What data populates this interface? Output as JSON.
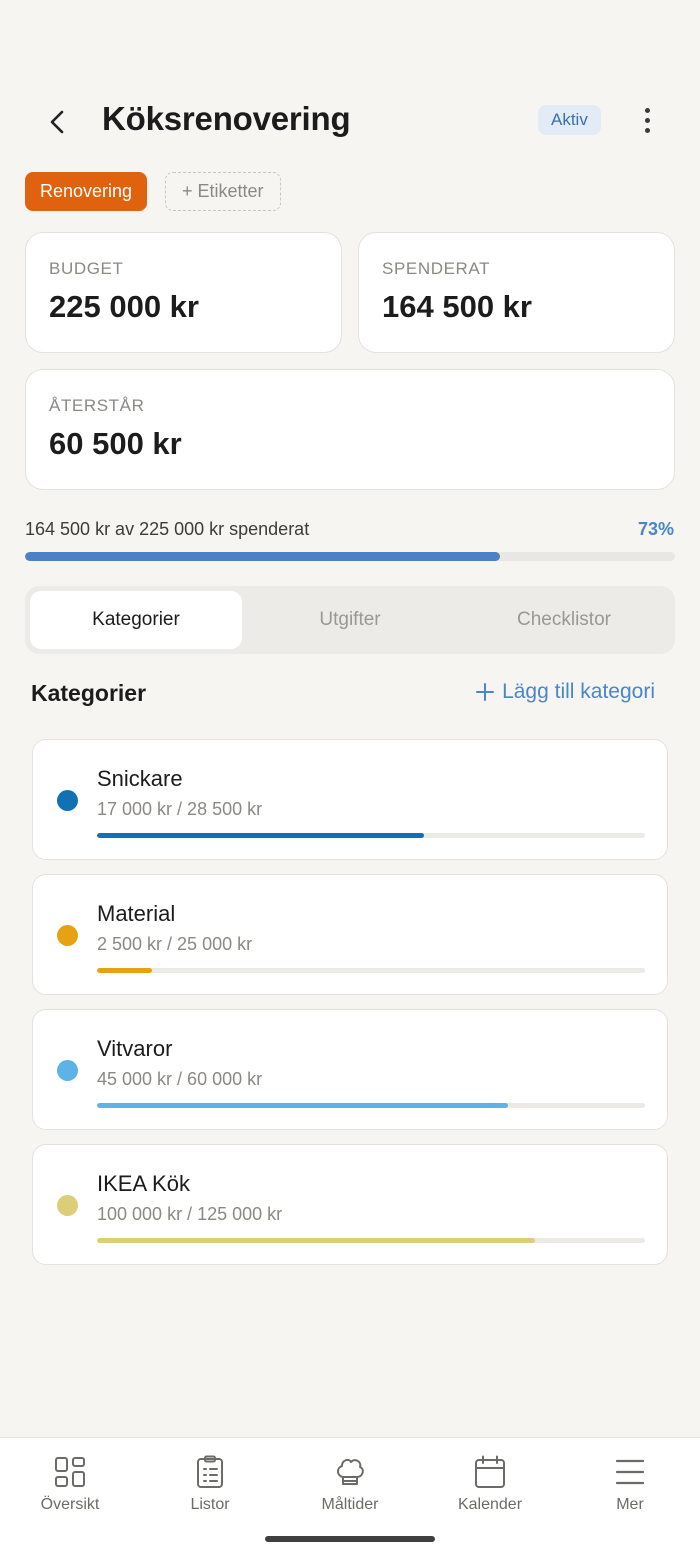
{
  "header": {
    "title": "Köksrenovering",
    "status": "Aktiv"
  },
  "tags": {
    "primary": "Renovering",
    "add_label": "+ Etiketter"
  },
  "stats": {
    "budget_label": "BUDGET",
    "budget_value": "225 000 kr",
    "spent_label": "SPENDERAT",
    "spent_value": "164 500 kr",
    "remaining_label": "ÅTERSTÅR",
    "remaining_value": "60 500 kr"
  },
  "progress": {
    "text": "164 500 kr av 225 000 kr spenderat",
    "percent_label": "73%",
    "fraction": 0.731
  },
  "tabs": [
    "Kategorier",
    "Utgifter",
    "Checklistor"
  ],
  "section": {
    "title": "Kategorier",
    "add_label": "Lägg till kategori"
  },
  "categories": [
    {
      "name": "Snickare",
      "amount": "17 000 kr / 28 500 kr",
      "fraction": 0.596,
      "color": "#1270b5"
    },
    {
      "name": "Material",
      "amount": "2 500 kr / 25 000 kr",
      "fraction": 0.1,
      "color": "#e6a212"
    },
    {
      "name": "Vitvaror",
      "amount": "45 000 kr / 60 000 kr",
      "fraction": 0.75,
      "color": "#5db3e6"
    },
    {
      "name": "IKEA Kök",
      "amount": "100 000 kr / 125 000 kr",
      "fraction": 0.8,
      "color": "#dccd78"
    }
  ],
  "nav": [
    "Översikt",
    "Listor",
    "Måltider",
    "Kalender",
    "Mer"
  ]
}
